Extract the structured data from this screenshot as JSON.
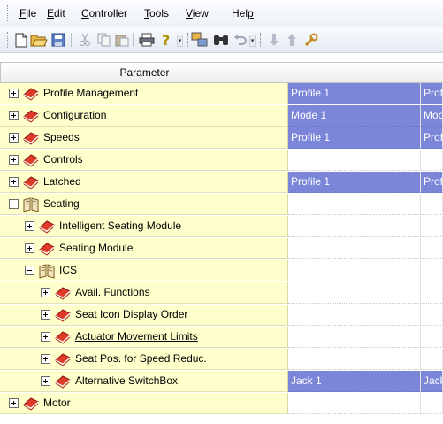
{
  "menu": {
    "items": [
      {
        "pre": "",
        "u": "F",
        "post": "ile"
      },
      {
        "pre": "",
        "u": "E",
        "post": "dit"
      },
      {
        "pre": "",
        "u": "C",
        "post": "ontroller"
      },
      {
        "pre": "",
        "u": "T",
        "post": "ools"
      },
      {
        "pre": "",
        "u": "V",
        "post": "iew"
      },
      {
        "pre": "Hel",
        "u": "p",
        "post": ""
      }
    ]
  },
  "toolbar": {
    "icons": [
      "new-file-icon",
      "open-folder-icon",
      "save-icon",
      "cut-icon",
      "copy-icon",
      "paste-icon",
      "print-icon",
      "help-icon",
      "toolbar-dropdown",
      "find-replace-icon",
      "binoculars-icon",
      "undo-icon",
      "toolbar-dropdown",
      "download-icon",
      "upload-icon",
      "tools-icon"
    ],
    "dropdown_glyph": "▾"
  },
  "grid": {
    "header": {
      "parameter": "Parameter",
      "col2": "",
      "col3": ""
    },
    "rows": [
      {
        "level": 0,
        "expander": "plus",
        "icon": "red-book",
        "label": "Profile Management",
        "v1": "Profile 1",
        "v2": "Prof",
        "highlight": true,
        "link": false
      },
      {
        "level": 0,
        "expander": "plus",
        "icon": "red-book",
        "label": "Configuration",
        "v1": "Mode 1",
        "v2": "Moc",
        "highlight": true,
        "link": false
      },
      {
        "level": 0,
        "expander": "plus",
        "icon": "red-book",
        "label": "Speeds",
        "v1": "Profile 1",
        "v2": "Prof",
        "highlight": true,
        "link": false
      },
      {
        "level": 0,
        "expander": "plus",
        "icon": "red-book",
        "label": "Controls",
        "v1": "",
        "v2": "",
        "highlight": false,
        "link": false
      },
      {
        "level": 0,
        "expander": "plus",
        "icon": "red-book",
        "label": "Latched",
        "v1": "Profile 1",
        "v2": "Prof",
        "highlight": true,
        "link": false
      },
      {
        "level": 0,
        "expander": "minus",
        "icon": "open-book",
        "label": "Seating",
        "v1": "",
        "v2": "",
        "highlight": false,
        "link": false
      },
      {
        "level": 1,
        "expander": "plus",
        "icon": "red-book",
        "label": "Intelligent Seating Module",
        "v1": "",
        "v2": "",
        "highlight": false,
        "link": false
      },
      {
        "level": 1,
        "expander": "plus",
        "icon": "red-book",
        "label": "Seating Module",
        "v1": "",
        "v2": "",
        "highlight": false,
        "link": false
      },
      {
        "level": 1,
        "expander": "minus",
        "icon": "open-book",
        "label": "ICS",
        "v1": "",
        "v2": "",
        "highlight": false,
        "link": false
      },
      {
        "level": 2,
        "expander": "plus",
        "icon": "red-book",
        "label": "Avail. Functions",
        "v1": "",
        "v2": "",
        "highlight": false,
        "link": false
      },
      {
        "level": 2,
        "expander": "plus",
        "icon": "red-book",
        "label": "Seat Icon Display Order",
        "v1": "",
        "v2": "",
        "highlight": false,
        "link": false
      },
      {
        "level": 2,
        "expander": "plus",
        "icon": "red-book",
        "label": "Actuator Movement Limits",
        "v1": "",
        "v2": "",
        "highlight": false,
        "link": true
      },
      {
        "level": 2,
        "expander": "plus",
        "icon": "red-book",
        "label": "Seat Pos. for Speed Reduc.",
        "v1": "",
        "v2": "",
        "highlight": false,
        "link": false
      },
      {
        "level": 2,
        "expander": "plus",
        "icon": "red-book",
        "label": "Alternative SwitchBox",
        "v1": "Jack 1",
        "v2": "Jack",
        "highlight": true,
        "link": false
      },
      {
        "level": 0,
        "expander": "plus",
        "icon": "red-book",
        "label": "Motor",
        "v1": "",
        "v2": "",
        "highlight": false,
        "link": false
      }
    ]
  }
}
